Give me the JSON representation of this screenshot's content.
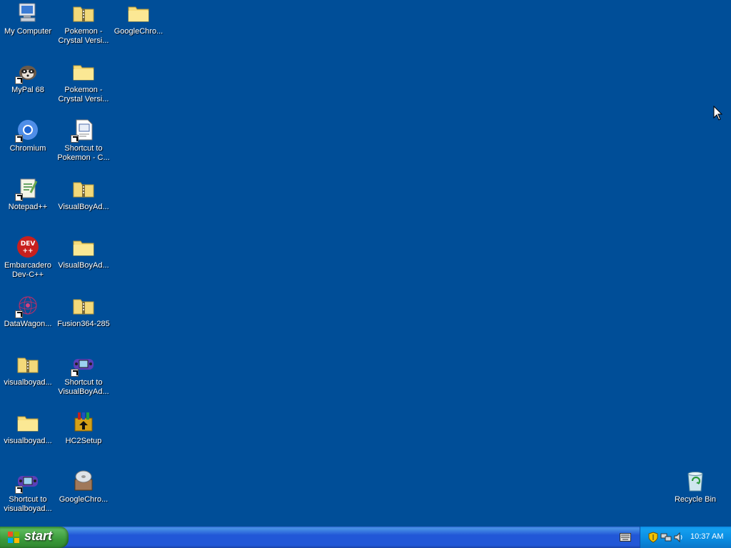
{
  "desktop": {
    "background_color": "#004e98",
    "icons": {
      "my_computer": "My Computer",
      "mypal": "MyPal 68",
      "chromium": "Chromium",
      "notepad": "Notepad++",
      "devcpp": "Embarcadero\nDev-C++",
      "datawagon": "DataWagon...",
      "vba_zip_1": "visualboyad...",
      "vba_folder_1": "visualboyad...",
      "shortcut_vba_lower": "Shortcut to\nvisualboyad...",
      "pokemon_zip": "Pokemon -\nCrystal Versi...",
      "pokemon_folder": "Pokemon -\nCrystal Versi...",
      "shortcut_pokemon": "Shortcut to\nPokemon - C...",
      "vba_zip_2": "VisualBoyAd...",
      "vba_folder_2": "VisualBoyAd...",
      "fusion": "Fusion364-285",
      "shortcut_vba_upper": "Shortcut to\nVisualBoyAd...",
      "hc2setup": "HC2Setup",
      "chrome_installer": "GoogleChro...",
      "chrome_folder": "GoogleChro...",
      "recycle_bin": "Recycle Bin"
    }
  },
  "taskbar": {
    "start_label": "start",
    "tray": {
      "clock": "10:37 AM",
      "icons": [
        "security-shield-icon",
        "network-icon",
        "volume-icon"
      ]
    },
    "language_bar_icon": "keyboard-icon"
  }
}
